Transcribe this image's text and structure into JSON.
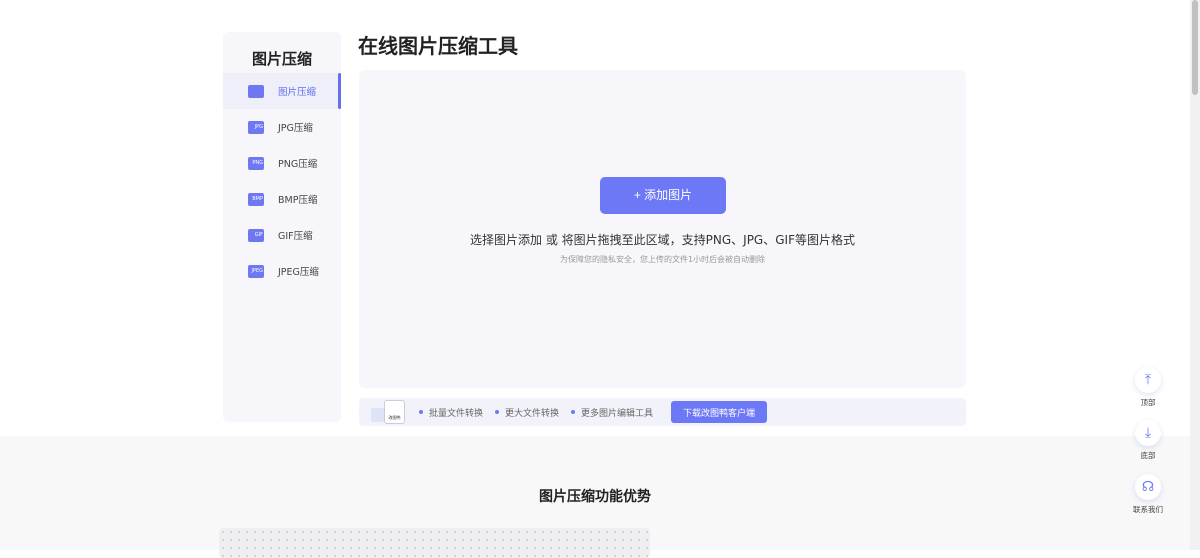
{
  "sidebar": {
    "title": "图片压缩",
    "items": [
      {
        "label": "图片压缩",
        "icon": ""
      },
      {
        "label": "JPG压缩",
        "icon": "JPG"
      },
      {
        "label": "PNG压缩",
        "icon": "PNG"
      },
      {
        "label": "BMP压缩",
        "icon": "BMP"
      },
      {
        "label": "GIF压缩",
        "icon": "GIF"
      },
      {
        "label": "JPEG压缩",
        "icon": "JPEG"
      }
    ]
  },
  "main": {
    "title": "在线图片压缩工具",
    "add_button": "+ 添加图片",
    "hint": "选择图片添加 或 将图片拖拽至此区域，支持PNG、JPG、GIF等图片格式",
    "privacy": "为保障您的隐私安全，您上传的文件1小时后会被自动删除"
  },
  "promo": {
    "app_name": "改图鸭",
    "features": [
      "批量文件转换",
      "更大文件转换",
      "更多图片编辑工具"
    ],
    "download": "下载改图鸭客户端"
  },
  "lower": {
    "title": "图片压缩功能优势"
  },
  "float": {
    "top": "顶部",
    "bottom": "底部",
    "contact": "联系我们"
  },
  "colors": {
    "accent": "#6c78f5"
  }
}
